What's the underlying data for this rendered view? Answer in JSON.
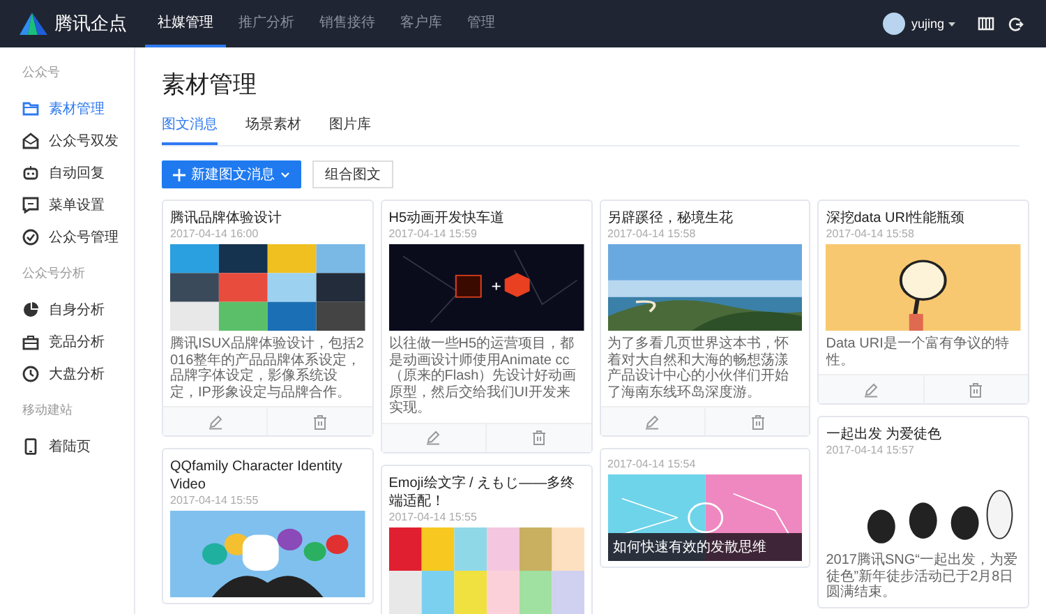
{
  "topbar": {
    "logo": "腾讯企点",
    "tabs": [
      {
        "label": "社媒管理",
        "selected": true
      },
      {
        "label": "推广分析",
        "selected": false
      },
      {
        "label": "销售接待",
        "selected": false
      },
      {
        "label": "客户库",
        "selected": false
      },
      {
        "label": "管理",
        "selected": false
      }
    ],
    "user": "yujing"
  },
  "sidebar": [
    {
      "title": "公众号",
      "items": [
        {
          "label": "素材管理",
          "selected": true
        },
        {
          "label": "公众号双发",
          "selected": false
        },
        {
          "label": "自动回复",
          "selected": false
        },
        {
          "label": "菜单设置",
          "selected": false
        },
        {
          "label": "公众号管理",
          "selected": false
        }
      ]
    },
    {
      "title": "公众号分析",
      "items": [
        {
          "label": "自身分析",
          "selected": false
        },
        {
          "label": "竞品分析",
          "selected": false
        },
        {
          "label": "大盘分析",
          "selected": false
        }
      ]
    },
    {
      "title": "移动建站",
      "items": [
        {
          "label": "着陆页",
          "selected": false
        }
      ]
    }
  ],
  "page_title": "素材管理",
  "tabs": [
    {
      "label": "图文消息",
      "selected": true
    },
    {
      "label": "场景素材",
      "selected": false
    },
    {
      "label": "图片库",
      "selected": false
    }
  ],
  "primary_button": "新建图文消息",
  "secondary_button": "组合图文",
  "columns": [
    [
      {
        "title": "腾讯品牌体验设计",
        "date": "2017-04-14 16:00",
        "description": "腾讯ISUX品牌体验设计，包括2016整年的产品品牌体系设定，品牌字体设定，影像系统设定，IP形象设定与品牌合作。",
        "toolbar": true
      },
      {
        "title": "QQfamily Character Identity Video",
        "date": "2017-04-14 15:55",
        "toolbar": false
      }
    ],
    [
      {
        "title": "H5动画开发快车道",
        "date": "2017-04-14 15:59",
        "description": "以往做一些H5的运营项目，都是动画设计师使用Animate cc（原来的Flash）先设计好动画原型，然后交给我们UI开发来实现。",
        "toolbar": true
      },
      {
        "title": "Emoji绘文字 / えもじ——多终端适配！",
        "date": "2017-04-14 15:55",
        "toolbar": false
      }
    ],
    [
      {
        "title": "另辟蹊径，秘境生花",
        "date": "2017-04-14 15:58",
        "description": "为了多看几页世界这本书，怀着对大自然和大海的畅想荡漾产品设计中心的小伙伴们开始了海南东线环岛深度游。",
        "toolbar": true
      },
      {
        "date": "2017-04-14 15:54",
        "image": {
          "kind": "picture",
          "caption": "如何快速有效的发散思维"
        },
        "toolbar": false
      }
    ],
    [
      {
        "title": "深挖data URI性能瓶颈",
        "date": "2017-04-14 15:58",
        "description": "Data URI是一个富有争议的特性。",
        "toolbar": true
      },
      {
        "title": "一起出发 为爱徒色",
        "date": "2017-04-14 15:57",
        "description": "2017腾讯SNG“一起出发，为爱徒色”新年徒步活动已于2月8日圆满结束。",
        "toolbar": false
      }
    ]
  ]
}
